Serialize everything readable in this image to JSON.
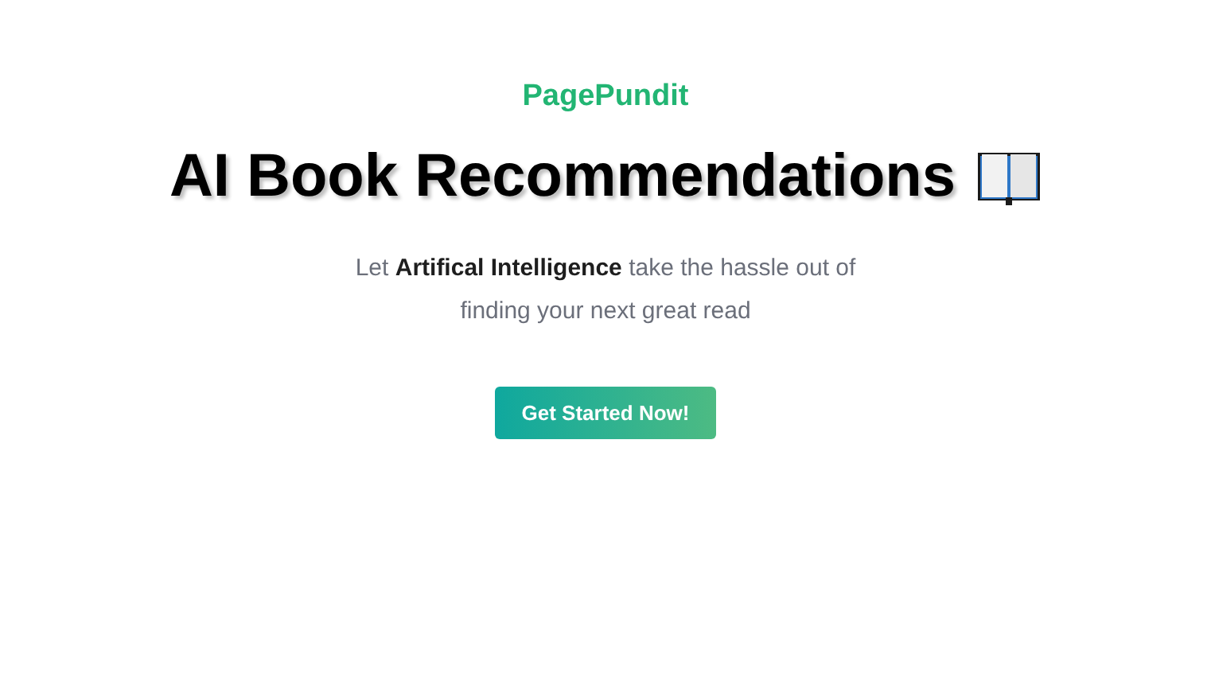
{
  "brand": "PagePundit",
  "heading": "AI Book Recommendations",
  "tagline": "Let **Artifical Intelligence** take the hassle out of finding your next great read",
  "cta": "Get Started Now!"
}
